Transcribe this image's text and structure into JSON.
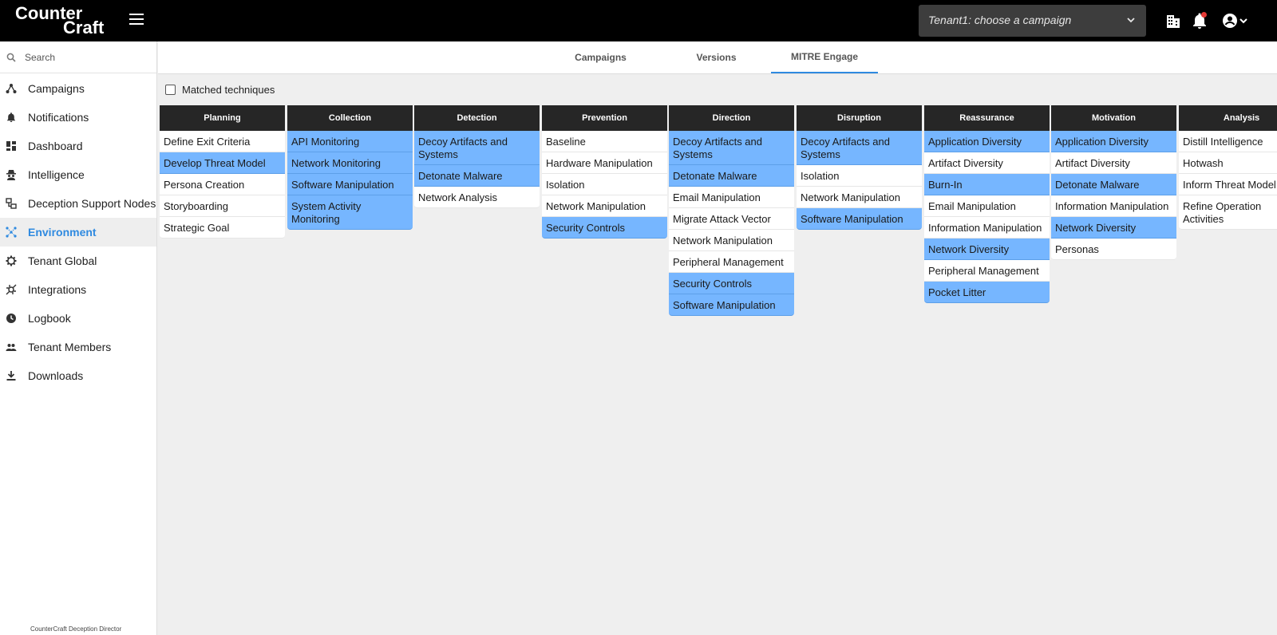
{
  "header": {
    "logo_line1": "Counter",
    "logo_line2": "Craft",
    "campaign_select": "Tenant1: choose a campaign"
  },
  "sidebar": {
    "search_placeholder": "Search",
    "items": [
      {
        "label": "Campaigns",
        "icon": "campaigns-icon"
      },
      {
        "label": "Notifications",
        "icon": "bell-icon"
      },
      {
        "label": "Dashboard",
        "icon": "dashboard-icon"
      },
      {
        "label": "Intelligence",
        "icon": "spy-icon"
      },
      {
        "label": "Deception Support Nodes",
        "icon": "nodes-icon"
      },
      {
        "label": "Environment",
        "icon": "environment-icon",
        "active": true
      },
      {
        "label": "Tenant Global",
        "icon": "gear-icon"
      },
      {
        "label": "Integrations",
        "icon": "integrations-icon"
      },
      {
        "label": "Logbook",
        "icon": "clock-icon"
      },
      {
        "label": "Tenant Members",
        "icon": "people-icon"
      },
      {
        "label": "Downloads",
        "icon": "download-icon"
      }
    ],
    "footer": "CounterCraft Deception Director"
  },
  "tabs": [
    {
      "label": "Campaigns",
      "active": false
    },
    {
      "label": "Versions",
      "active": false
    },
    {
      "label": "MITRE Engage",
      "active": true
    }
  ],
  "filter": {
    "matched_label": "Matched techniques",
    "checked": false
  },
  "colors": {
    "highlight": "#76b6ff",
    "accent": "#2f8ae0",
    "header": "#262626"
  },
  "matrix": [
    {
      "title": "Planning",
      "items": [
        {
          "label": "Define Exit Criteria",
          "hl": false
        },
        {
          "label": "Develop Threat Model",
          "hl": true
        },
        {
          "label": "Persona Creation",
          "hl": false
        },
        {
          "label": "Storyboarding",
          "hl": false
        },
        {
          "label": "Strategic Goal",
          "hl": false
        }
      ]
    },
    {
      "title": "Collection",
      "items": [
        {
          "label": "API Monitoring",
          "hl": true
        },
        {
          "label": "Network Monitoring",
          "hl": true
        },
        {
          "label": "Software Manipulation",
          "hl": true
        },
        {
          "label": "System Activity\nMonitoring",
          "hl": true
        }
      ]
    },
    {
      "title": "Detection",
      "items": [
        {
          "label": "Decoy Artifacts and\nSystems",
          "hl": true
        },
        {
          "label": "Detonate Malware",
          "hl": true
        },
        {
          "label": "Network Analysis",
          "hl": false
        }
      ]
    },
    {
      "title": "Prevention",
      "items": [
        {
          "label": "Baseline",
          "hl": false
        },
        {
          "label": "Hardware Manipulation",
          "hl": false
        },
        {
          "label": "Isolation",
          "hl": false
        },
        {
          "label": "Network Manipulation",
          "hl": false
        },
        {
          "label": "Security Controls",
          "hl": true
        }
      ]
    },
    {
      "title": "Direction",
      "items": [
        {
          "label": "Decoy Artifacts and\nSystems",
          "hl": true
        },
        {
          "label": "Detonate Malware",
          "hl": true
        },
        {
          "label": "Email Manipulation",
          "hl": false
        },
        {
          "label": "Migrate Attack Vector",
          "hl": false
        },
        {
          "label": "Network Manipulation",
          "hl": false
        },
        {
          "label": "Peripheral Management",
          "hl": false
        },
        {
          "label": "Security Controls",
          "hl": true
        },
        {
          "label": "Software Manipulation",
          "hl": true
        }
      ]
    },
    {
      "title": "Disruption",
      "items": [
        {
          "label": "Decoy Artifacts and\nSystems",
          "hl": true
        },
        {
          "label": "Isolation",
          "hl": false
        },
        {
          "label": "Network Manipulation",
          "hl": false
        },
        {
          "label": "Software Manipulation",
          "hl": true
        }
      ]
    },
    {
      "title": "Reassurance",
      "items": [
        {
          "label": "Application Diversity",
          "hl": true
        },
        {
          "label": "Artifact Diversity",
          "hl": false
        },
        {
          "label": "Burn-In",
          "hl": true
        },
        {
          "label": "Email Manipulation",
          "hl": false
        },
        {
          "label": "Information Manipulation",
          "hl": false
        },
        {
          "label": "Network Diversity",
          "hl": true
        },
        {
          "label": "Peripheral Management",
          "hl": false
        },
        {
          "label": "Pocket Litter",
          "hl": true
        }
      ]
    },
    {
      "title": "Motivation",
      "items": [
        {
          "label": "Application Diversity",
          "hl": true
        },
        {
          "label": "Artifact Diversity",
          "hl": false
        },
        {
          "label": "Detonate Malware",
          "hl": true
        },
        {
          "label": "Information Manipulation",
          "hl": false
        },
        {
          "label": "Network Diversity",
          "hl": true
        },
        {
          "label": "Personas",
          "hl": false
        }
      ]
    },
    {
      "title": "Analysis",
      "items": [
        {
          "label": "Distill Intelligence",
          "hl": false
        },
        {
          "label": "Hotwash",
          "hl": false
        },
        {
          "label": "Inform Threat Model",
          "hl": false
        },
        {
          "label": "Refine Operation\nActivities",
          "hl": false
        }
      ]
    }
  ]
}
